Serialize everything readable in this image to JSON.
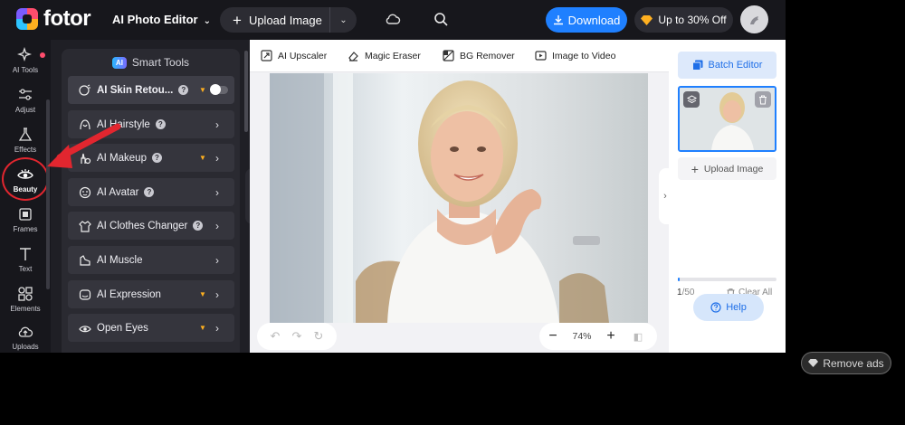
{
  "header": {
    "logo_text": "fotor",
    "editor_title": "AI Photo Editor",
    "upload_label": "Upload Image",
    "download_label": "Download",
    "offer_label": "Up to 30% Off"
  },
  "rail": {
    "items": [
      {
        "label": "AI Tools",
        "icon": "sparkle-icon"
      },
      {
        "label": "Adjust",
        "icon": "sliders-icon"
      },
      {
        "label": "Effects",
        "icon": "flask-icon"
      },
      {
        "label": "Beauty",
        "icon": "eye-icon",
        "active": true
      },
      {
        "label": "Frames",
        "icon": "frame-icon"
      },
      {
        "label": "Text",
        "icon": "text-icon"
      },
      {
        "label": "Elements",
        "icon": "shapes-icon"
      },
      {
        "label": "Uploads",
        "icon": "cloud-upload-icon"
      }
    ]
  },
  "tools_panel": {
    "badge": "AI",
    "title": "Smart Tools",
    "rows": [
      {
        "label": "AI Skin Retou...",
        "help": true,
        "crown": true,
        "toggle": true
      },
      {
        "label": "AI Hairstyle",
        "help": true,
        "crown": false
      },
      {
        "label": "AI Makeup",
        "help": true,
        "crown": true
      },
      {
        "label": "AI Avatar",
        "help": true,
        "crown": false
      },
      {
        "label": "AI Clothes Changer",
        "help": true,
        "crown": false
      },
      {
        "label": "AI Muscle",
        "help": false,
        "crown": false
      },
      {
        "label": "AI Expression",
        "help": false,
        "crown": true
      },
      {
        "label": "Open Eyes",
        "help": false,
        "crown": true
      }
    ]
  },
  "canvas_toolbar": {
    "items": [
      "AI Upscaler",
      "Magic Eraser",
      "BG Remover",
      "Image to Video"
    ]
  },
  "zoom": {
    "value": "74%"
  },
  "right_panel": {
    "batch_label": "Batch Editor",
    "upload_label": "Upload Image",
    "count_current": "1",
    "count_total": "/50",
    "progress_fraction": 0.02,
    "clear_label": "Clear All",
    "help_label": "Help"
  },
  "remove_ads_label": "Remove ads",
  "colors": {
    "accent": "#1f80ff",
    "annotation": "#e2262f",
    "crown": "#ffb020"
  }
}
